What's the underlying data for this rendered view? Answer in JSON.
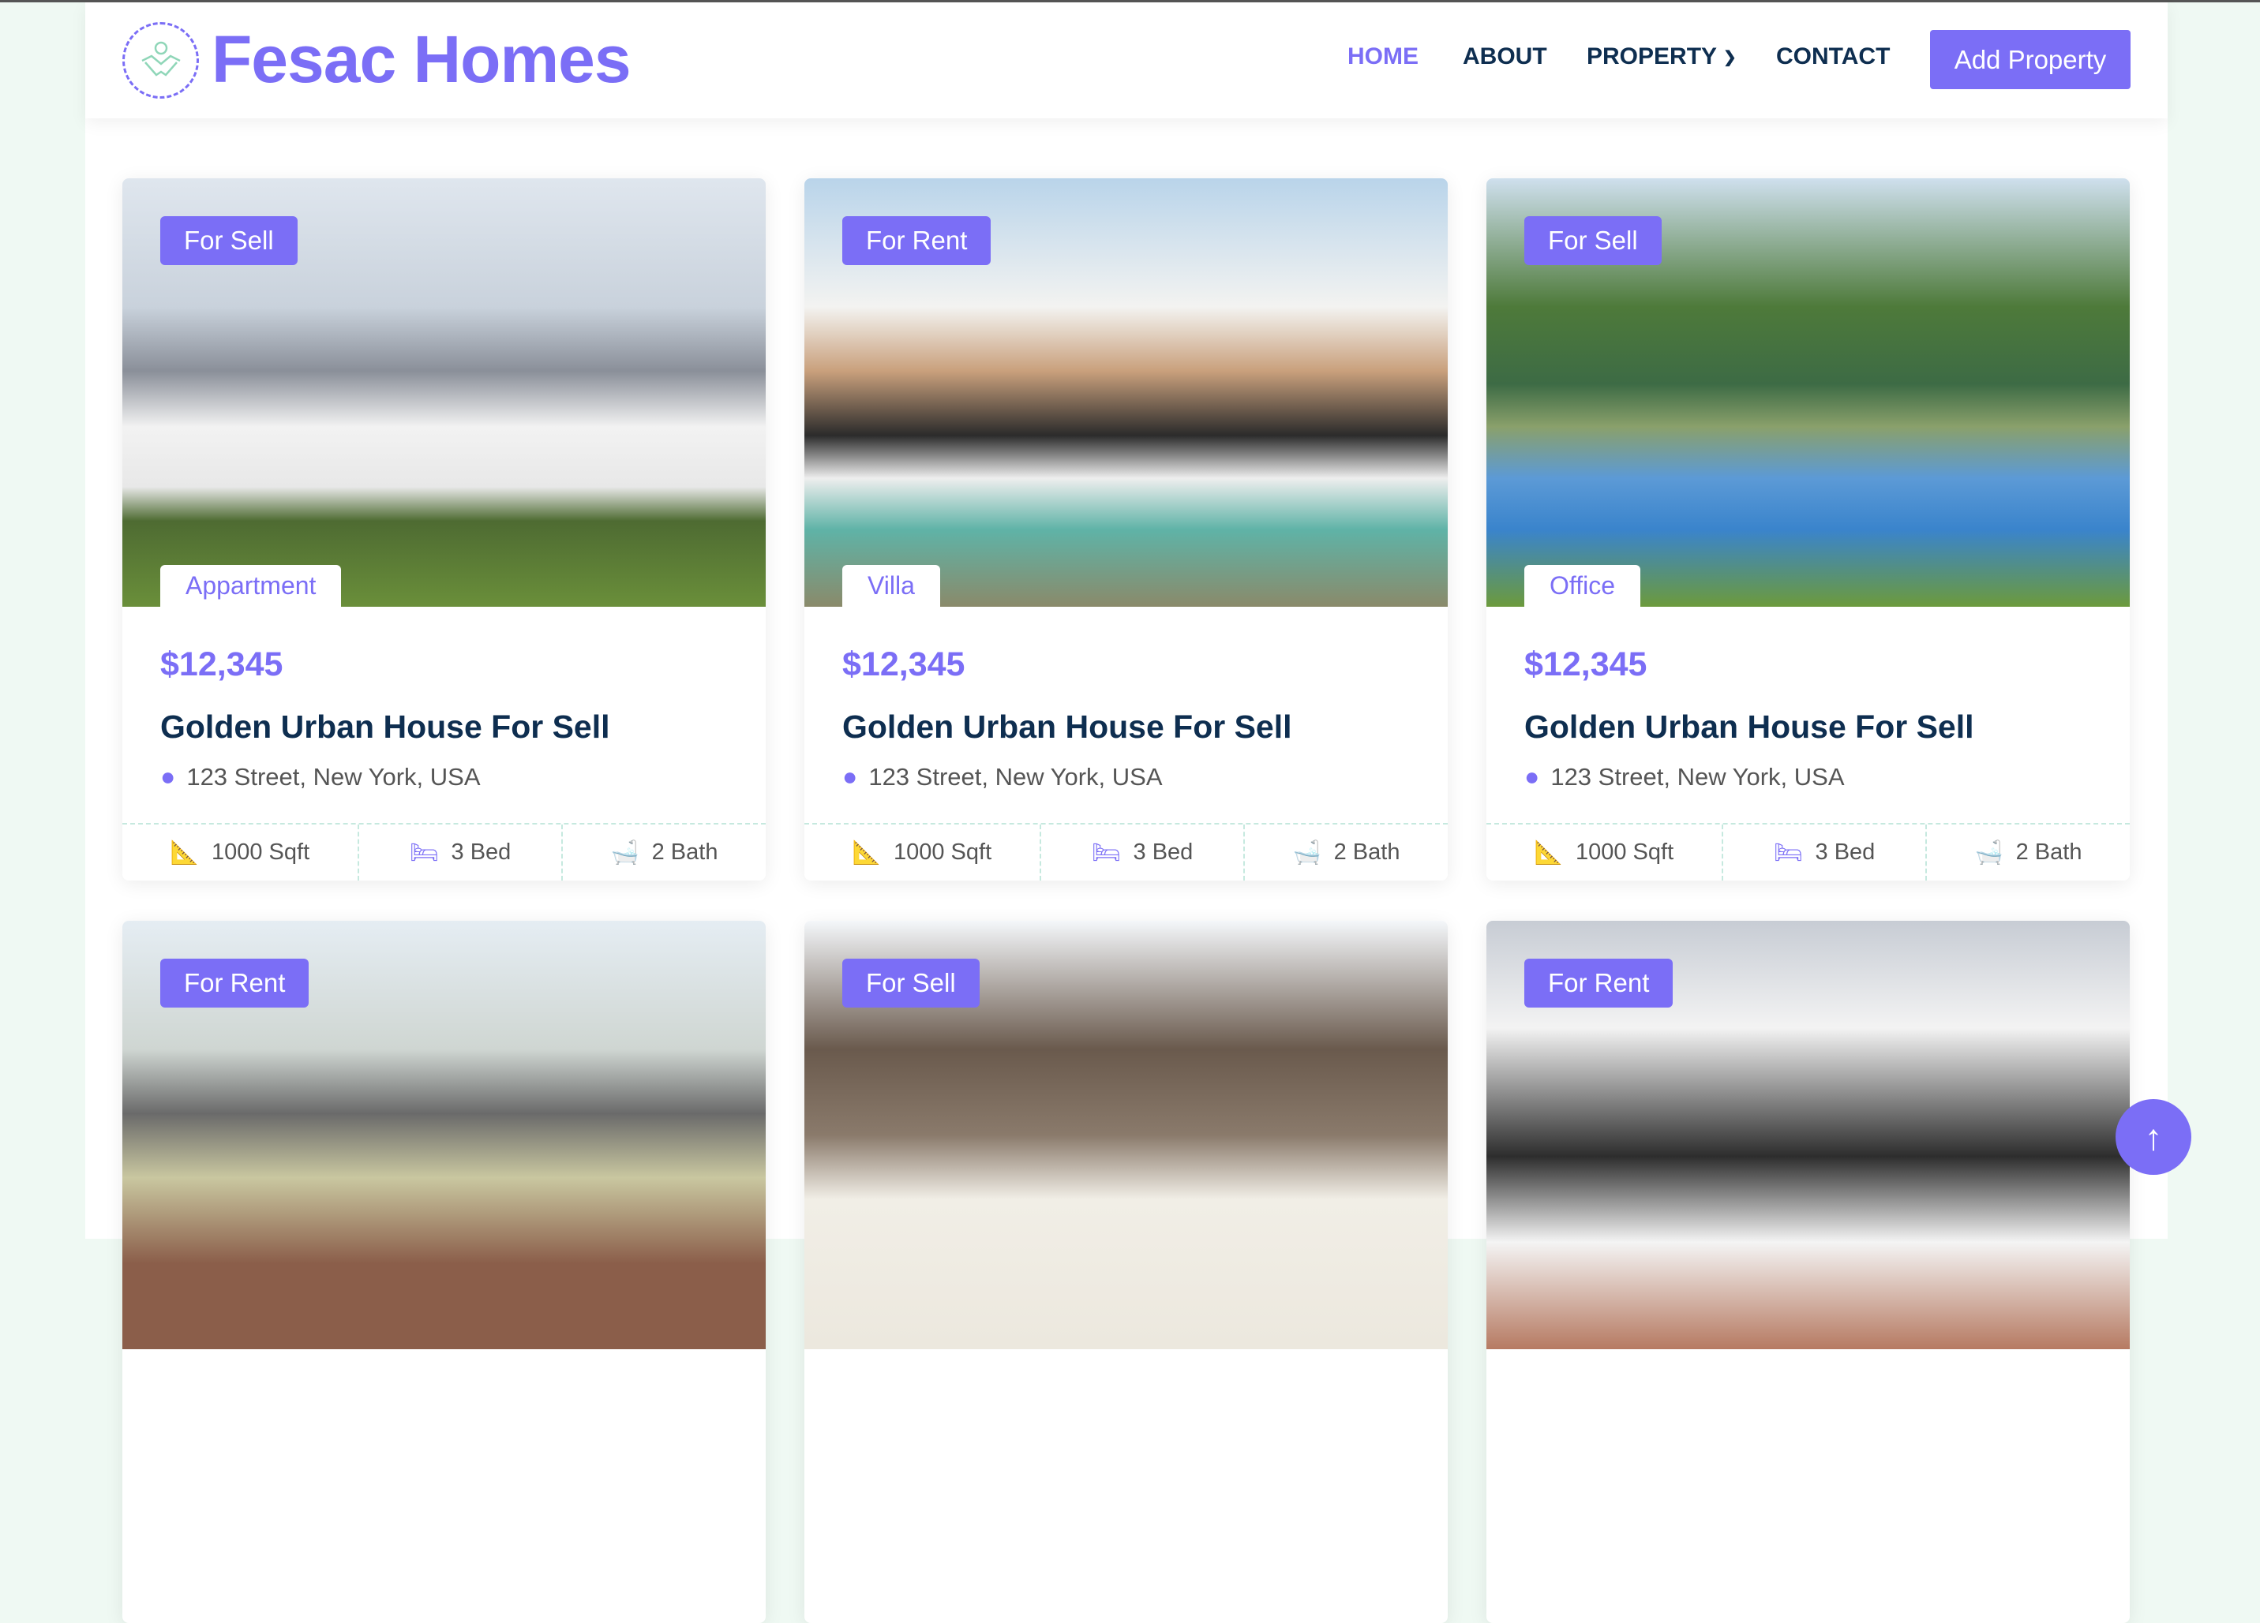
{
  "brand": {
    "name": "Fesac Homes",
    "logo_icon": "handshake-money-icon"
  },
  "nav": {
    "items": [
      "HOME",
      "ABOUT",
      "PROPERTY",
      "CONTACT"
    ],
    "active": "HOME",
    "add_button": "Add Property"
  },
  "colors": {
    "accent": "#7b6ef6",
    "heading": "#0e2e50"
  },
  "listings": [
    {
      "badge": "For Sell",
      "category": "Appartment",
      "price": "$12,345",
      "title": "Golden Urban House For Sell",
      "address": "123 Street, New York, USA",
      "sqft": "1000 Sqft",
      "bed": "3 Bed",
      "bath": "2 Bath"
    },
    {
      "badge": "For Rent",
      "category": "Villa",
      "price": "$12,345",
      "title": "Golden Urban House For Sell",
      "address": "123 Street, New York, USA",
      "sqft": "1000 Sqft",
      "bed": "3 Bed",
      "bath": "2 Bath"
    },
    {
      "badge": "For Sell",
      "category": "Office",
      "price": "$12,345",
      "title": "Golden Urban House For Sell",
      "address": "123 Street, New York, USA",
      "sqft": "1000 Sqft",
      "bed": "3 Bed",
      "bath": "2 Bath"
    },
    {
      "badge": "For Rent"
    },
    {
      "badge": "For Sell"
    },
    {
      "badge": "For Rent"
    }
  ],
  "back_to_top": "↑"
}
